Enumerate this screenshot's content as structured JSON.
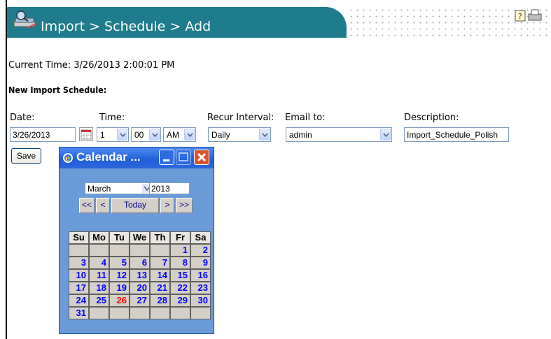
{
  "header": {
    "title": "Import > Schedule > Add",
    "color": "#1e7c8c",
    "icon": "import-search-icon",
    "tools": [
      "help-icon",
      "print-icon"
    ]
  },
  "current_time": "Current Time: 3/26/2013 2:00:01 PM",
  "section_title": "New Import Schedule:",
  "form": {
    "date_label": "Date:",
    "time_label": "Time:",
    "recur_label": "Recur Interval:",
    "email_label": "Email to:",
    "desc_label": "Description:",
    "date_value": "3/26/2013",
    "hour_value": "1",
    "minute_value": "00",
    "ampm_value": "AM",
    "recur_value": "Daily",
    "email_value": "admin",
    "desc_value": "Import_Schedule_Polish",
    "save_label": "Save"
  },
  "calendar": {
    "title": "Calendar ...",
    "month": "March",
    "year": "2013",
    "nav": [
      "<<",
      "<",
      "Today",
      ">",
      ">>"
    ],
    "weekdays": [
      "Su",
      "Mo",
      "Tu",
      "We",
      "Th",
      "Fr",
      "Sa"
    ],
    "weeks": [
      [
        "",
        "",
        "",
        "",
        "",
        "1",
        "2"
      ],
      [
        "3",
        "4",
        "5",
        "6",
        "7",
        "8",
        "9"
      ],
      [
        "10",
        "11",
        "12",
        "13",
        "14",
        "15",
        "16"
      ],
      [
        "17",
        "18",
        "19",
        "20",
        "21",
        "22",
        "23"
      ],
      [
        "24",
        "25",
        "26",
        "27",
        "28",
        "29",
        "30"
      ],
      [
        "31",
        "",
        "",
        "",
        "",
        "",
        ""
      ]
    ],
    "today": "26",
    "day_color": "#0000ff",
    "today_color": "#ff0000"
  }
}
